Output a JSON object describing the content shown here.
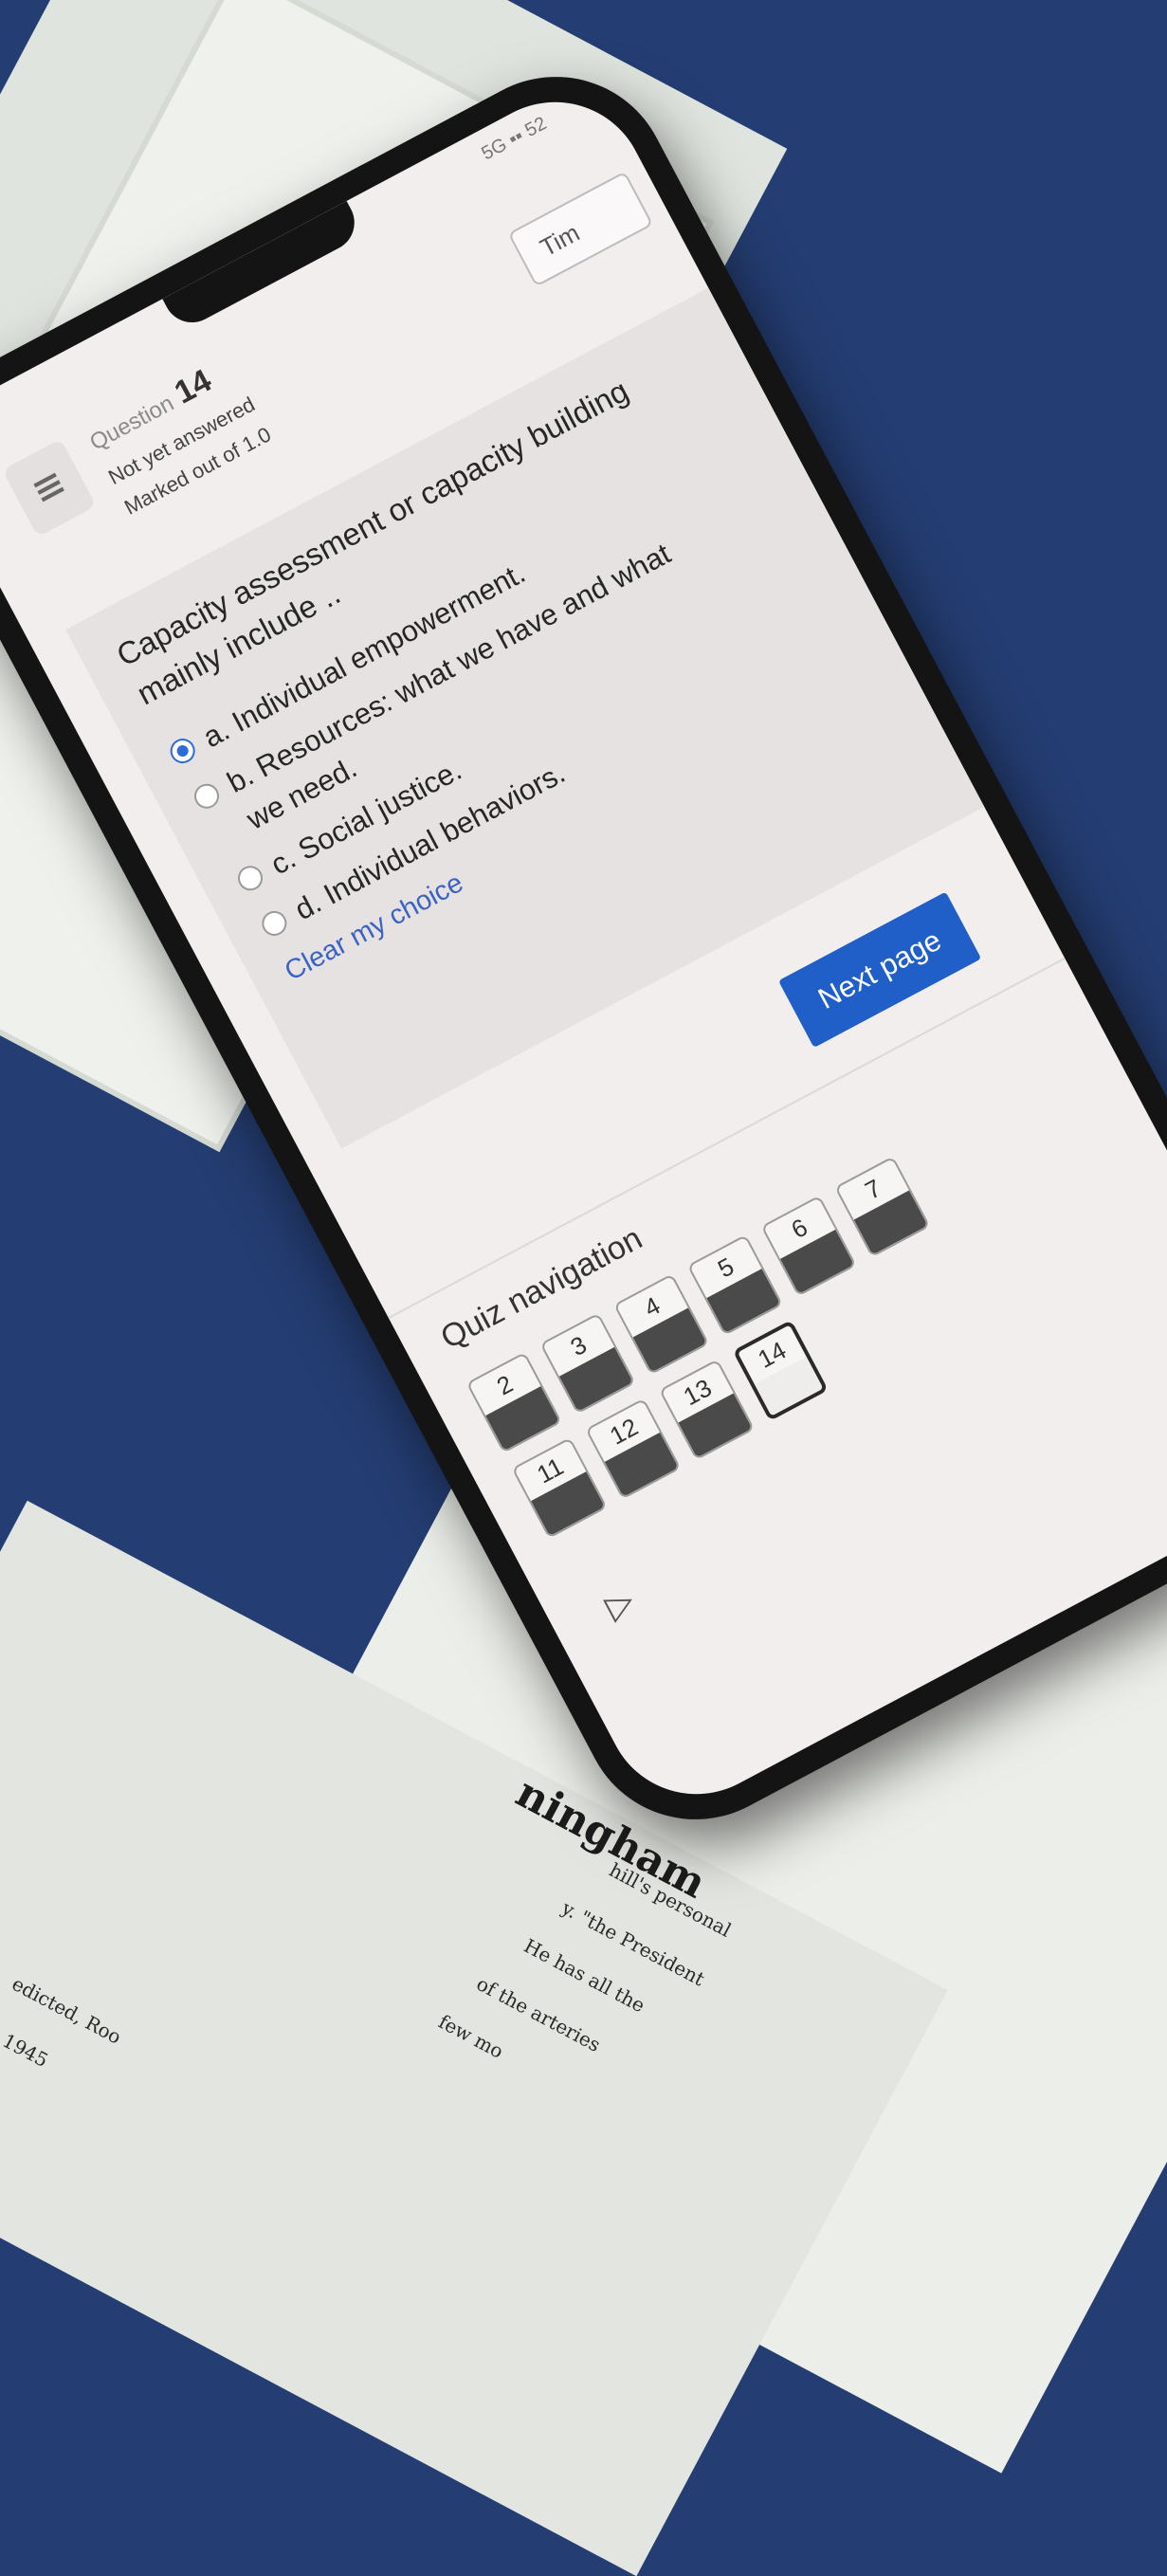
{
  "background": {
    "heading": "ningham",
    "lines": [
      "hill's personal",
      "y. \"the President",
      "He has all the",
      "of the arteries",
      "few mo",
      "edicted, Roo",
      "1945"
    ]
  },
  "status_bar": {
    "text": "5G ▪▪ 52"
  },
  "question": {
    "label": "Question",
    "number": "14",
    "status": "Not yet answered",
    "marks": "Marked out of 1.0",
    "timer_label": "Tim",
    "text": "Capacity assessment or capacity building mainly include ..",
    "options": [
      {
        "label": "a. Individual empowerment.",
        "selected": true
      },
      {
        "label": "b. Resources: what we have and what we need.",
        "selected": false
      },
      {
        "label": "c. Social justice.",
        "selected": false
      },
      {
        "label": "d. Individual behaviors.",
        "selected": false
      }
    ],
    "clear_choice": "Clear my choice"
  },
  "next_page_label": "Next page",
  "quiz_nav": {
    "title": "Quiz navigation",
    "cells": [
      {
        "n": "2"
      },
      {
        "n": "3"
      },
      {
        "n": "4"
      },
      {
        "n": "5"
      },
      {
        "n": "6"
      },
      {
        "n": "7"
      },
      {
        "n": "11"
      },
      {
        "n": "12"
      },
      {
        "n": "13"
      },
      {
        "n": "14",
        "current": true
      }
    ],
    "arrow": "▷"
  },
  "colors": {
    "accent": "#1f5fc7",
    "link": "#3b63c4",
    "answered_fill": "#4a4a4a"
  }
}
